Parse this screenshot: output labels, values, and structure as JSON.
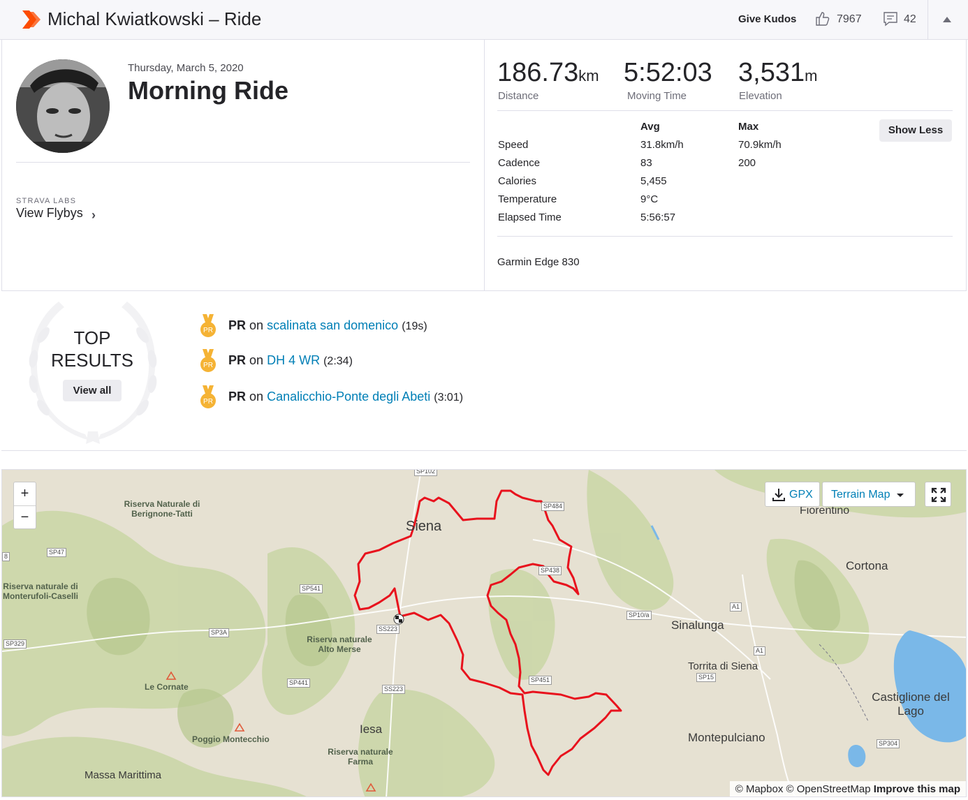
{
  "header": {
    "title": "Michal Kwiatkowski – Ride",
    "give_kudos": "Give Kudos",
    "kudos_count": "7967",
    "comment_count": "42"
  },
  "activity": {
    "date": "Thursday, March 5, 2020",
    "name": "Morning Ride",
    "labs_label": "STRAVA LABS",
    "flybys_label": "View Flybys",
    "flybys_chevron": "›"
  },
  "stats": {
    "distance": {
      "value": "186.73",
      "unit": "km",
      "label": "Distance"
    },
    "moving_time": {
      "value": "5:52:03",
      "label": "Moving Time"
    },
    "elevation": {
      "value": "3,531",
      "unit": "m",
      "label": "Elevation"
    },
    "col_avg": "Avg",
    "col_max": "Max",
    "show_less": "Show Less",
    "rows": [
      {
        "label": "Speed",
        "avg": "31.8km/h",
        "max": "70.9km/h"
      },
      {
        "label": "Cadence",
        "avg": "83",
        "max": "200"
      },
      {
        "label": "Calories",
        "avg": "5,455",
        "max": ""
      },
      {
        "label": "Temperature",
        "avg": "9°C",
        "max": ""
      },
      {
        "label": "Elapsed Time",
        "avg": "5:56:57",
        "max": ""
      }
    ],
    "device": "Garmin Edge 830"
  },
  "top_results": {
    "title_line1": "TOP",
    "title_line2": "RESULTS",
    "view_all": "View all",
    "items": [
      {
        "badge": "PR",
        "label": "PR",
        "on": "on",
        "segment": "scalinata san domenico",
        "time": "(19s)"
      },
      {
        "badge": "PR",
        "label": "PR",
        "on": "on",
        "segment": "DH 4 WR",
        "time": "(2:34)"
      },
      {
        "badge": "PR",
        "label": "PR",
        "on": "on",
        "segment": "Canalicchio-Ponte degli Abeti",
        "time": "(3:01)"
      }
    ]
  },
  "map": {
    "zoom_in": "+",
    "zoom_out": "−",
    "gpx": "GPX",
    "terrain": "Terrain Map",
    "attribution_a": "© Mapbox © OpenStreetMap",
    "attribution_b": "Improve this map",
    "labels": {
      "siena": "Siena",
      "firenze": "Fiorentino",
      "cortona": "Cortona",
      "sinalunga": "Sinalunga",
      "torrita": "Torrita di Siena",
      "castiglione": "Castiglione del Lago",
      "montepulciano": "Montepulciano",
      "iesa": "Iesa",
      "massa": "Massa Marittima",
      "le_cornate": "Le Cornate",
      "poggio": "Poggio Montecchio",
      "riserva_berignone": "Riserva Naturale di Berignone-Tatti",
      "riserva_monterufoli": "Riserva naturale di Monterufoli-Caselli",
      "riserva_alto_merse": "Riserva naturale Alto Merse",
      "riserva_farma": "Riserva naturale Farma",
      "sp47": "SP47",
      "sp541": "SP541",
      "sp3a": "SP3A",
      "sp441": "SP441",
      "ss223a": "SS223",
      "ss223b": "SS223",
      "sp329": "SP329",
      "sp484": "SP484",
      "sp438": "SP438",
      "sp451": "SP451",
      "sp10a": "SP10/a",
      "a1a": "A1",
      "a1b": "A1",
      "sp15": "SP15",
      "sp304": "SP304",
      "sp102": "SP102",
      "n8": "8"
    },
    "route_color": "#e8121d",
    "water_color": "#7ab8e8"
  },
  "colors": {
    "brand": "#fc4c02",
    "link": "#007fb6"
  }
}
